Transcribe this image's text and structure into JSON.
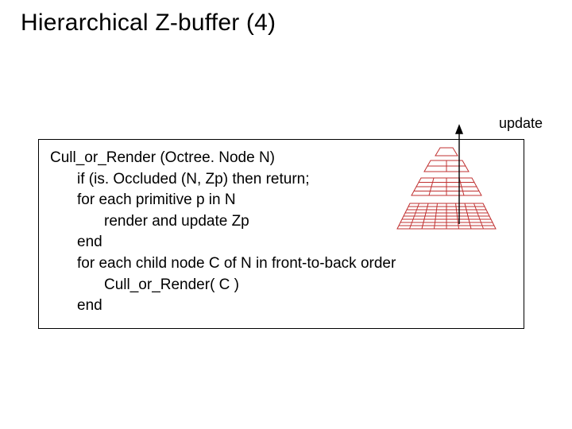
{
  "title": "Hierarchical Z-buffer (4)",
  "update_label": "update",
  "algo": {
    "l0": "Cull_or_Render (Octree. Node N)",
    "l1": "if (is. Occluded (N, Zp) then return;",
    "l2": "for each primitive p in N",
    "l3": "render and update Zp",
    "l4": "end",
    "l5": "for each child node C of N in front-to-back order",
    "l6": "Cull_or_Render( C )",
    "l7": "end"
  },
  "diagram": {
    "name": "z-pyramid",
    "levels": 4,
    "base_grid": "8x8",
    "arrow": "update-arrow"
  }
}
